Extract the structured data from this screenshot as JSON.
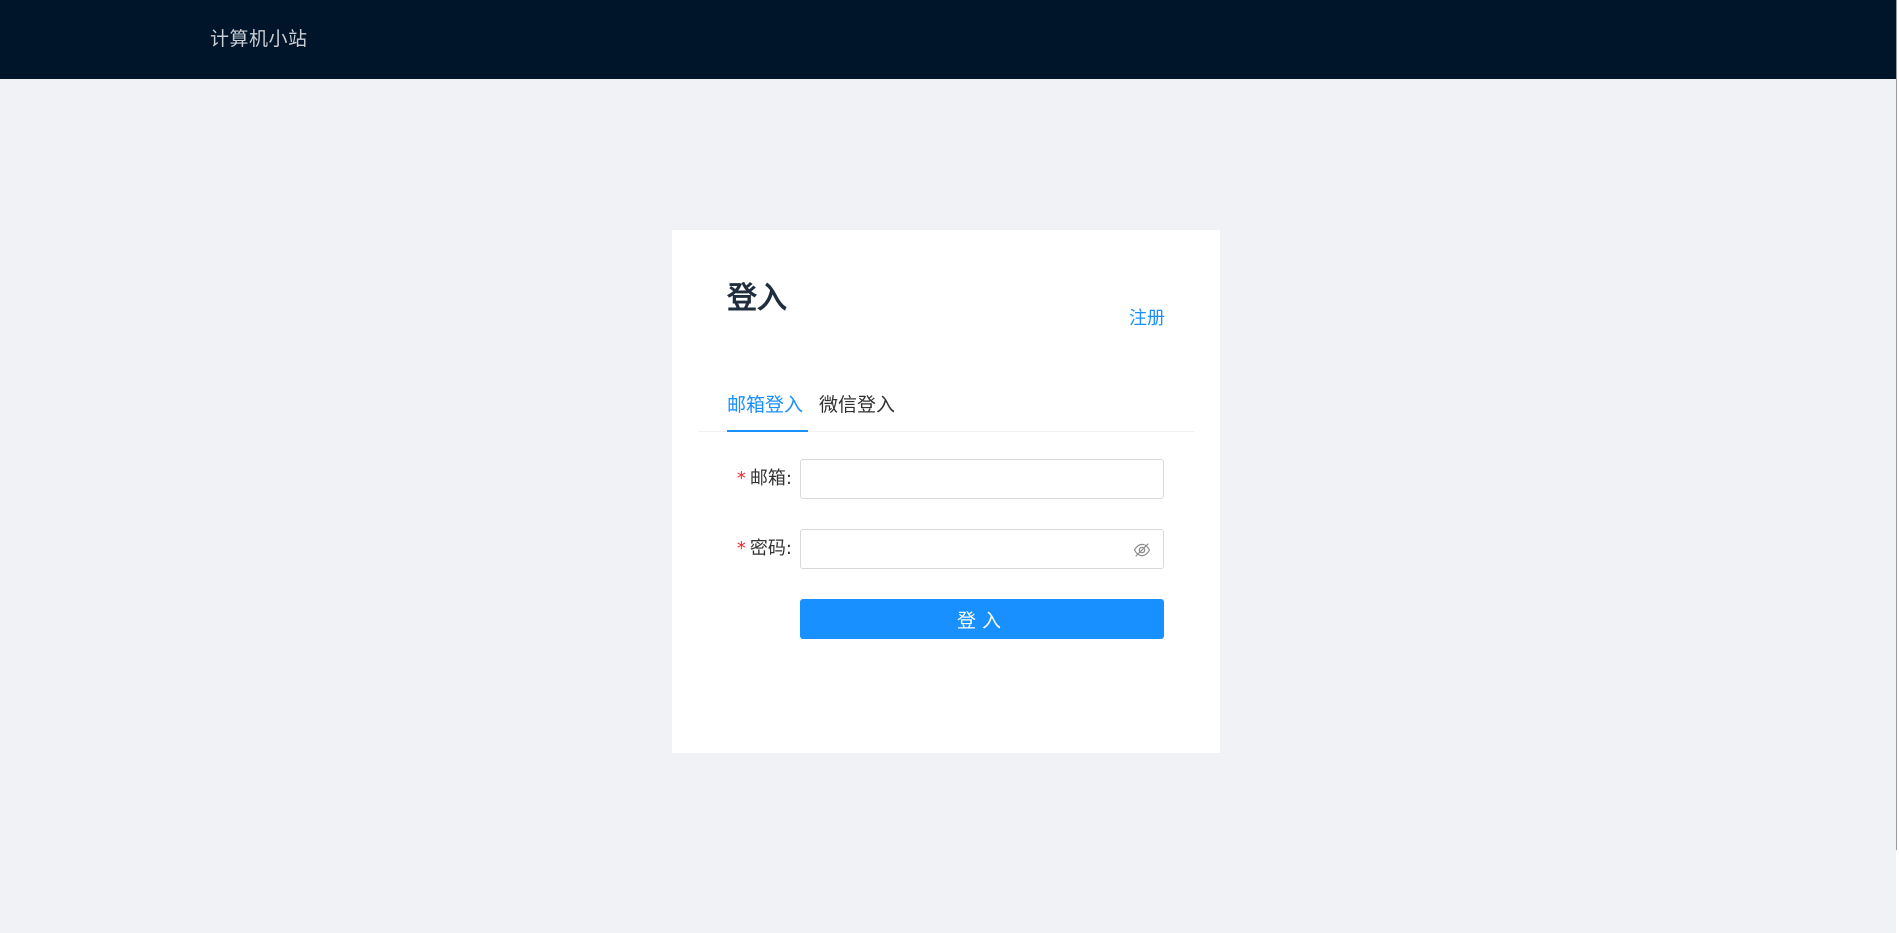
{
  "header": {
    "brand": "计算机小站"
  },
  "login_card": {
    "title": "登入",
    "register_link": "注册",
    "tabs": [
      {
        "label": "邮箱登入",
        "active": true
      },
      {
        "label": "微信登入",
        "active": false
      }
    ],
    "form": {
      "email": {
        "required_mark": "*",
        "label": "邮箱:",
        "value": ""
      },
      "password": {
        "required_mark": "*",
        "label": "密码:",
        "value": "",
        "visibility_icon": "eye-hidden-icon"
      },
      "submit_label": "登入"
    }
  },
  "colors": {
    "header_bg": "#001529",
    "page_bg": "#f0f2f5",
    "accent": "#1890ff",
    "required": "#f5222d"
  }
}
